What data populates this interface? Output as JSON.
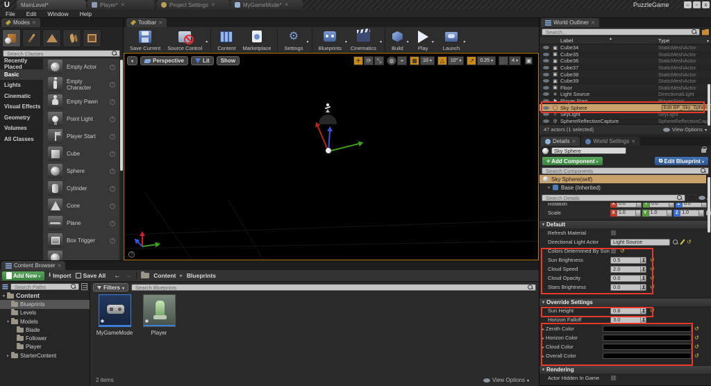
{
  "window": {
    "project_name": "PuzzleGame",
    "tabs": [
      {
        "label": "MainLevel*"
      },
      {
        "label": "Player*"
      },
      {
        "label": "Project Settings"
      },
      {
        "label": "MyGameMode*"
      }
    ],
    "controls": {
      "minimize": "–",
      "maximize": "▫",
      "close": "x"
    }
  },
  "menu": {
    "file": "File",
    "edit": "Edit",
    "window": "Window",
    "help": "Help"
  },
  "modes": {
    "tab": "Modes",
    "search_placeholder": "Search Classes",
    "categories": [
      "Recently Placed",
      "Basic",
      "Lights",
      "Cinematic",
      "Visual Effects",
      "Geometry",
      "Volumes",
      "All Classes"
    ],
    "items": [
      "Empty Actor",
      "Empty Character",
      "Empty Pawn",
      "Point Light",
      "Player Start",
      "Cube",
      "Sphere",
      "Cylinder",
      "Cone",
      "Plane",
      "Box Trigger"
    ]
  },
  "toolbar": {
    "tab": "Toolbar",
    "save_current": "Save Current",
    "source_control": "Source Control",
    "content": "Content",
    "marketplace": "Marketplace",
    "settings": "Settings",
    "blueprints": "Blueprints",
    "cinematics": "Cinematics",
    "build": "Build",
    "play": "Play",
    "launch": "Launch"
  },
  "viewport": {
    "perspective": "Perspective",
    "lit": "Lit",
    "show": "Show",
    "grid_snap": "10",
    "angle_snap": "10°",
    "scale_snap": "0.25",
    "camera_speed": "4",
    "axis_y": "y"
  },
  "outliner": {
    "tab": "World Outliner",
    "search_placeholder": "Search...",
    "col_label": "Label",
    "col_type": "Type",
    "rows": [
      {
        "label": "Cube34",
        "type": "StaticMeshActor"
      },
      {
        "label": "Cube35",
        "type": "StaticMeshActor"
      },
      {
        "label": "Cube36",
        "type": "StaticMeshActor"
      },
      {
        "label": "Cube37",
        "type": "StaticMeshActor"
      },
      {
        "label": "Cube38",
        "type": "StaticMeshActor"
      },
      {
        "label": "Cube39",
        "type": "StaticMeshActor"
      },
      {
        "label": "Floor",
        "type": "StaticMeshActor"
      },
      {
        "label": "Light Source",
        "type": "DirectionalLight"
      },
      {
        "label": "Player Start",
        "type": "PlayerStart"
      },
      {
        "label": "Sky Sphere",
        "type": "Edit BP_Sky_Sphere"
      },
      {
        "label": "SkyLight",
        "type": "SkyLight"
      },
      {
        "label": "SphereReflectionCapture",
        "type": "SphereReflectionCapt"
      }
    ],
    "footer": "47 actors (1 selected)",
    "view_options": "View Options"
  },
  "details": {
    "tab_details": "Details",
    "tab_world_settings": "World Settings",
    "actor_name": "Sky Sphere",
    "add_component": "Add Component",
    "edit_blueprint": "Edit Blueprint",
    "search_components_placeholder": "Search Components",
    "component_self": "Sky Sphere(self)",
    "component_base": "Base (Inherited)",
    "search_details_placeholder": "Search Details",
    "transform": {
      "rotation_label": "Rotation",
      "rotation": {
        "x": "0.0",
        "y": "0.0",
        "z": "0.0"
      },
      "scale_label": "Scale",
      "scale": {
        "x": "1.0",
        "y": "1.0",
        "z": "1.0"
      }
    },
    "default_section": {
      "title": "Default",
      "refresh_material": "Refresh Material",
      "directional_light_actor": "Directional Light Actor",
      "directional_light_value": "Light Source",
      "colors_determined": "Colors Determined By Sun P",
      "sun_brightness_label": "Sun Brightness",
      "sun_brightness": "0.5",
      "cloud_speed_label": "Cloud Speed",
      "cloud_speed": "2.0",
      "cloud_opacity_label": "Cloud Opacity",
      "cloud_opacity": "0.0",
      "stars_brightness_label": "Stars Brightness",
      "stars_brightness": "0.0"
    },
    "override_section": {
      "title": "Override Settings",
      "sun_height_label": "Sun Height",
      "sun_height": "0.6",
      "horizon_falloff_label": "Horizon Falloff",
      "horizon_falloff": "3.0",
      "zenith_color": "Zenith Color",
      "horizon_color": "Horizon Color",
      "cloud_color": "Cloud Color",
      "overall_color": "Overall Color"
    },
    "rendering_section": {
      "title": "Rendering",
      "actor_hidden": "Actor Hidden In Game"
    }
  },
  "content_browser": {
    "tab": "Content Browser",
    "add_new": "Add New",
    "import": "Import",
    "save_all": "Save All",
    "breadcrumb_root": "Content",
    "breadcrumb_current": "Blueprints",
    "search_paths_placeholder": "Search Paths",
    "tree": [
      {
        "name": "Content"
      },
      {
        "name": "Blueprints"
      },
      {
        "name": "Levels"
      },
      {
        "name": "Models"
      },
      {
        "name": "Blade"
      },
      {
        "name": "Follower"
      },
      {
        "name": "Player"
      },
      {
        "name": "StarterContent"
      }
    ],
    "filters": "Filters",
    "search_placeholder": "Search Blueprints",
    "assets": [
      {
        "name": "MyGameMode"
      },
      {
        "name": "Player"
      }
    ],
    "items_count": "2 items",
    "view_options": "View Options"
  },
  "colors": {
    "annotation_red": "#e8392b",
    "selection_tan": "#c9a16b",
    "accent_green": "#3a7f3f",
    "accent_blue": "#2d538c",
    "viewport_border": "#b8860b"
  }
}
